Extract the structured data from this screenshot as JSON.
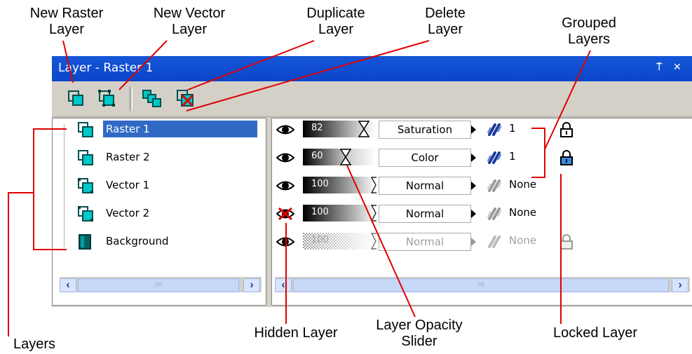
{
  "callouts": {
    "new_raster_layer": "New Raster\nLayer",
    "new_vector_layer": "New Vector\nLayer",
    "duplicate_layer": "Duplicate\nLayer",
    "delete_layer": "Delete\nLayer",
    "grouped_layers": "Grouped\nLayers",
    "layers": "Layers",
    "hidden_layer": "Hidden Layer",
    "layer_opacity_slider": "Layer Opacity\nSlider",
    "locked_layer": "Locked Layer"
  },
  "palette": {
    "title": "Layer - Raster 1",
    "pin_glyph": "⍑",
    "close_glyph": "✕",
    "scroll_left": "‹",
    "scroll_right": "›",
    "thumb_grip": "IIII"
  },
  "layers": [
    {
      "name": "Raster 1",
      "type": "raster",
      "selected": true,
      "visible": true,
      "opacity": "82",
      "blend": "Saturation",
      "group": "1",
      "locked": true
    },
    {
      "name": "Raster 2",
      "type": "raster",
      "selected": false,
      "visible": true,
      "opacity": "60",
      "blend": "Color",
      "group": "1",
      "locked": true
    },
    {
      "name": "Vector 1",
      "type": "vector",
      "selected": false,
      "visible": true,
      "opacity": "100",
      "blend": "Normal",
      "group": "None",
      "locked": false
    },
    {
      "name": "Vector 2",
      "type": "vector",
      "selected": false,
      "visible": false,
      "opacity": "100",
      "blend": "Normal",
      "group": "None",
      "locked": false
    },
    {
      "name": "Background",
      "type": "background",
      "selected": false,
      "visible": true,
      "opacity": "100",
      "blend": "Normal",
      "group": "None",
      "locked": false,
      "disabled": true
    }
  ],
  "colors": {
    "titlebar": "#0a45c9",
    "callout_line": "#e00000",
    "selection": "#316ac5",
    "layer_icon": "#00a0a0"
  },
  "icons": [
    "new-raster-layer-icon",
    "new-vector-layer-icon",
    "duplicate-layer-icon",
    "delete-layer-icon",
    "eye-icon",
    "chain-link-icon",
    "padlock-icon"
  ]
}
